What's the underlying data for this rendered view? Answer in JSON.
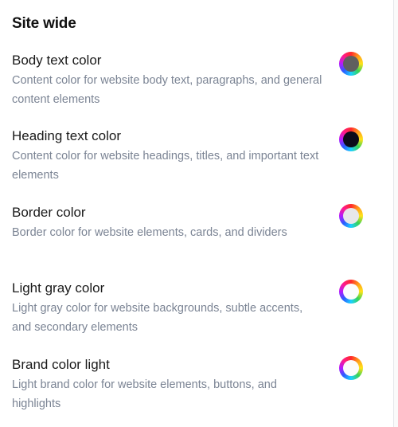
{
  "section": {
    "title": "Site wide"
  },
  "settings": [
    {
      "label": "Body text color",
      "description": "Content color for website body text, paragraphs, and general content elements",
      "color": "#5f5f5f"
    },
    {
      "label": "Heading text color",
      "description": "Content color for website headings, titles, and important text elements",
      "color": "#0b0b1a"
    },
    {
      "label": "Border color",
      "description": "Border color for website elements, cards, and dividers",
      "color": "#e7e7ea"
    },
    {
      "label": "Light gray color",
      "description": "Light gray color for website backgrounds, subtle accents, and secondary elements",
      "color": "#fcfcfd"
    },
    {
      "label": "Brand color light",
      "description": "Light brand color for website elements, buttons, and highlights",
      "color": "#fbfbfc"
    }
  ]
}
